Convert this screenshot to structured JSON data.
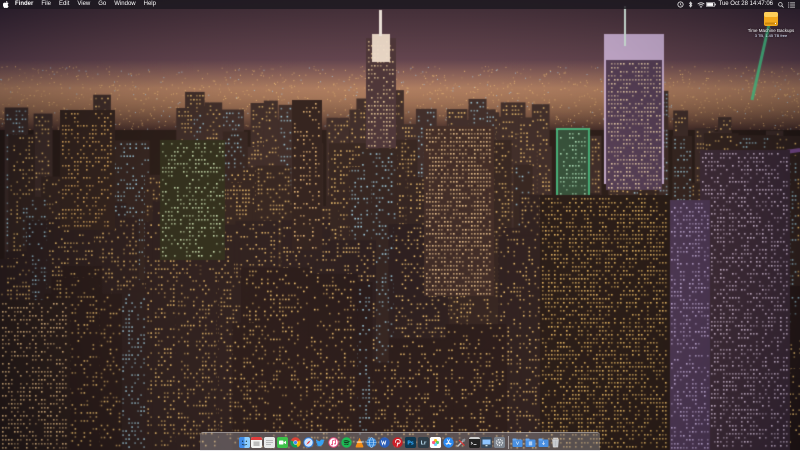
{
  "menubar": {
    "app_name": "Finder",
    "menus": [
      "File",
      "Edit",
      "View",
      "Go",
      "Window",
      "Help"
    ],
    "status_icons": [
      "time-machine-icon",
      "bluetooth-icon",
      "wifi-icon",
      "battery-icon"
    ],
    "clock": "Tue Oct 28  14:47:06",
    "right_icons": [
      "search-icon",
      "notification-center-icon"
    ]
  },
  "desktop": {
    "disk": {
      "name": "Time Machine Backups",
      "free": "3 TB, 1.45 TB free",
      "icon": "external-drive-icon"
    }
  },
  "dock": {
    "apps": [
      {
        "id": "finder",
        "icon": "finder-icon",
        "color": "#3f8be6"
      },
      {
        "id": "calendar",
        "icon": "calendar-icon",
        "color": "#f4f4f4"
      },
      {
        "id": "notes",
        "icon": "notes-icon",
        "color": "#e9e9e9"
      },
      {
        "id": "facetime",
        "icon": "facetime-icon",
        "color": "#3ec24a"
      },
      {
        "id": "chrome",
        "icon": "chrome-icon",
        "color": "#e8e8e8"
      },
      {
        "id": "safari",
        "icon": "safari-icon",
        "color": "#2d7be0"
      },
      {
        "id": "twitter",
        "icon": "twitter-icon",
        "color": "#38a1f3"
      },
      {
        "id": "itunes",
        "icon": "itunes-icon",
        "color": "#e9487a"
      },
      {
        "id": "spotify",
        "icon": "spotify-icon",
        "color": "#1db954"
      },
      {
        "id": "vlc",
        "icon": "vlc-icon",
        "color": "#f28c16"
      },
      {
        "id": "network",
        "icon": "globe-icon",
        "color": "#2f7fd0"
      },
      {
        "id": "word",
        "icon": "word-icon",
        "color": "#2b5db8"
      },
      {
        "id": "pinterest",
        "icon": "pinterest-icon",
        "color": "#cb1f27"
      },
      {
        "id": "photoshop",
        "icon": "photoshop-icon",
        "color": "#0f3850"
      },
      {
        "id": "lightroom",
        "icon": "lightroom-icon",
        "color": "#2f3d48"
      },
      {
        "id": "photos",
        "icon": "photos-icon",
        "color": "#ffffff"
      },
      {
        "id": "appstore",
        "icon": "app-store-icon",
        "color": "#2d8af1"
      },
      {
        "id": "utilities",
        "icon": "tools-icon",
        "color": "#8a8f96"
      },
      {
        "id": "terminal",
        "icon": "terminal-icon",
        "color": "#222222"
      },
      {
        "id": "monitor",
        "icon": "monitor-icon",
        "color": "#3b4a5a"
      },
      {
        "id": "preferences",
        "icon": "gear-icon",
        "color": "#7d8590"
      }
    ],
    "folders": [
      {
        "id": "applications",
        "icon": "folder-icon",
        "color": "#4a90e2"
      },
      {
        "id": "documents",
        "icon": "folder-icon",
        "color": "#4a90e2"
      },
      {
        "id": "downloads",
        "icon": "folder-icon",
        "color": "#4a90e2"
      }
    ],
    "trash": {
      "icon": "trash-icon",
      "color": "#d4d6da"
    }
  },
  "wallpaper": {
    "sky_top": "#2a1f36",
    "sky_bottom": "#6a4a62",
    "light_warm": "#ffd27a",
    "light_cool": "#9fe0ff",
    "neon_green": "#39e6a0",
    "neon_purple": "#b36bff"
  }
}
